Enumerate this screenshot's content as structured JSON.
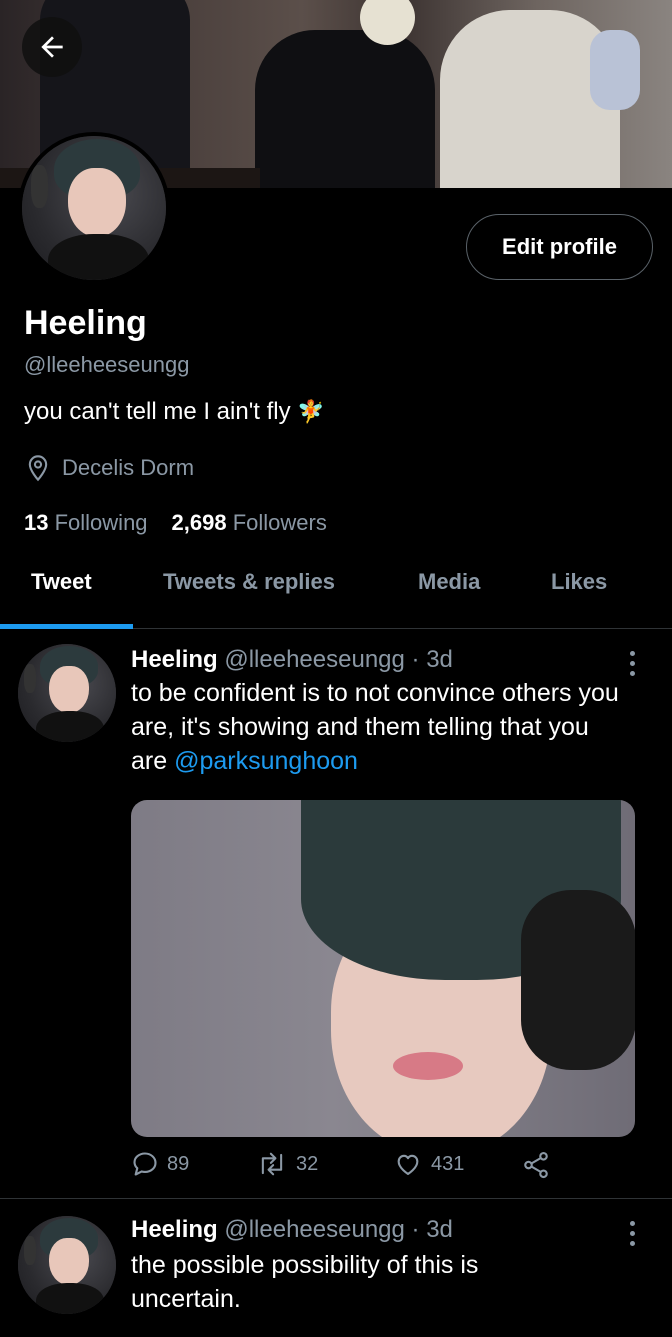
{
  "profile": {
    "name": "Heeling",
    "handle": "@lleeheeseungg",
    "bio": "you can't tell me I ain't fly",
    "bio_emoji": "🧚",
    "location": "Decelis Dorm",
    "following_count": "13",
    "following_label": "Following",
    "followers_count": "2,698",
    "followers_label": "Followers",
    "edit_label": "Edit profile"
  },
  "tabs": [
    {
      "label": "Tweet"
    },
    {
      "label": "Tweets & replies"
    },
    {
      "label": "Media"
    },
    {
      "label": "Likes"
    }
  ],
  "tweets": [
    {
      "name": "Heeling",
      "handle": "@lleeheeseungg",
      "time": "· 3d",
      "text": "to be confident is to not convince others you are, it's showing and them telling that you are",
      "mention": "@parksunghoon",
      "replies": "89",
      "retweets": "32",
      "likes": "431"
    },
    {
      "name": "Heeling",
      "handle": "@lleeheeseungg",
      "time": "· 3d",
      "text": "the possible possibility of this is uncertain."
    }
  ],
  "colors": {
    "accent": "#1d9bf0",
    "secondary_text": "#8b98a5",
    "background": "#000000"
  }
}
